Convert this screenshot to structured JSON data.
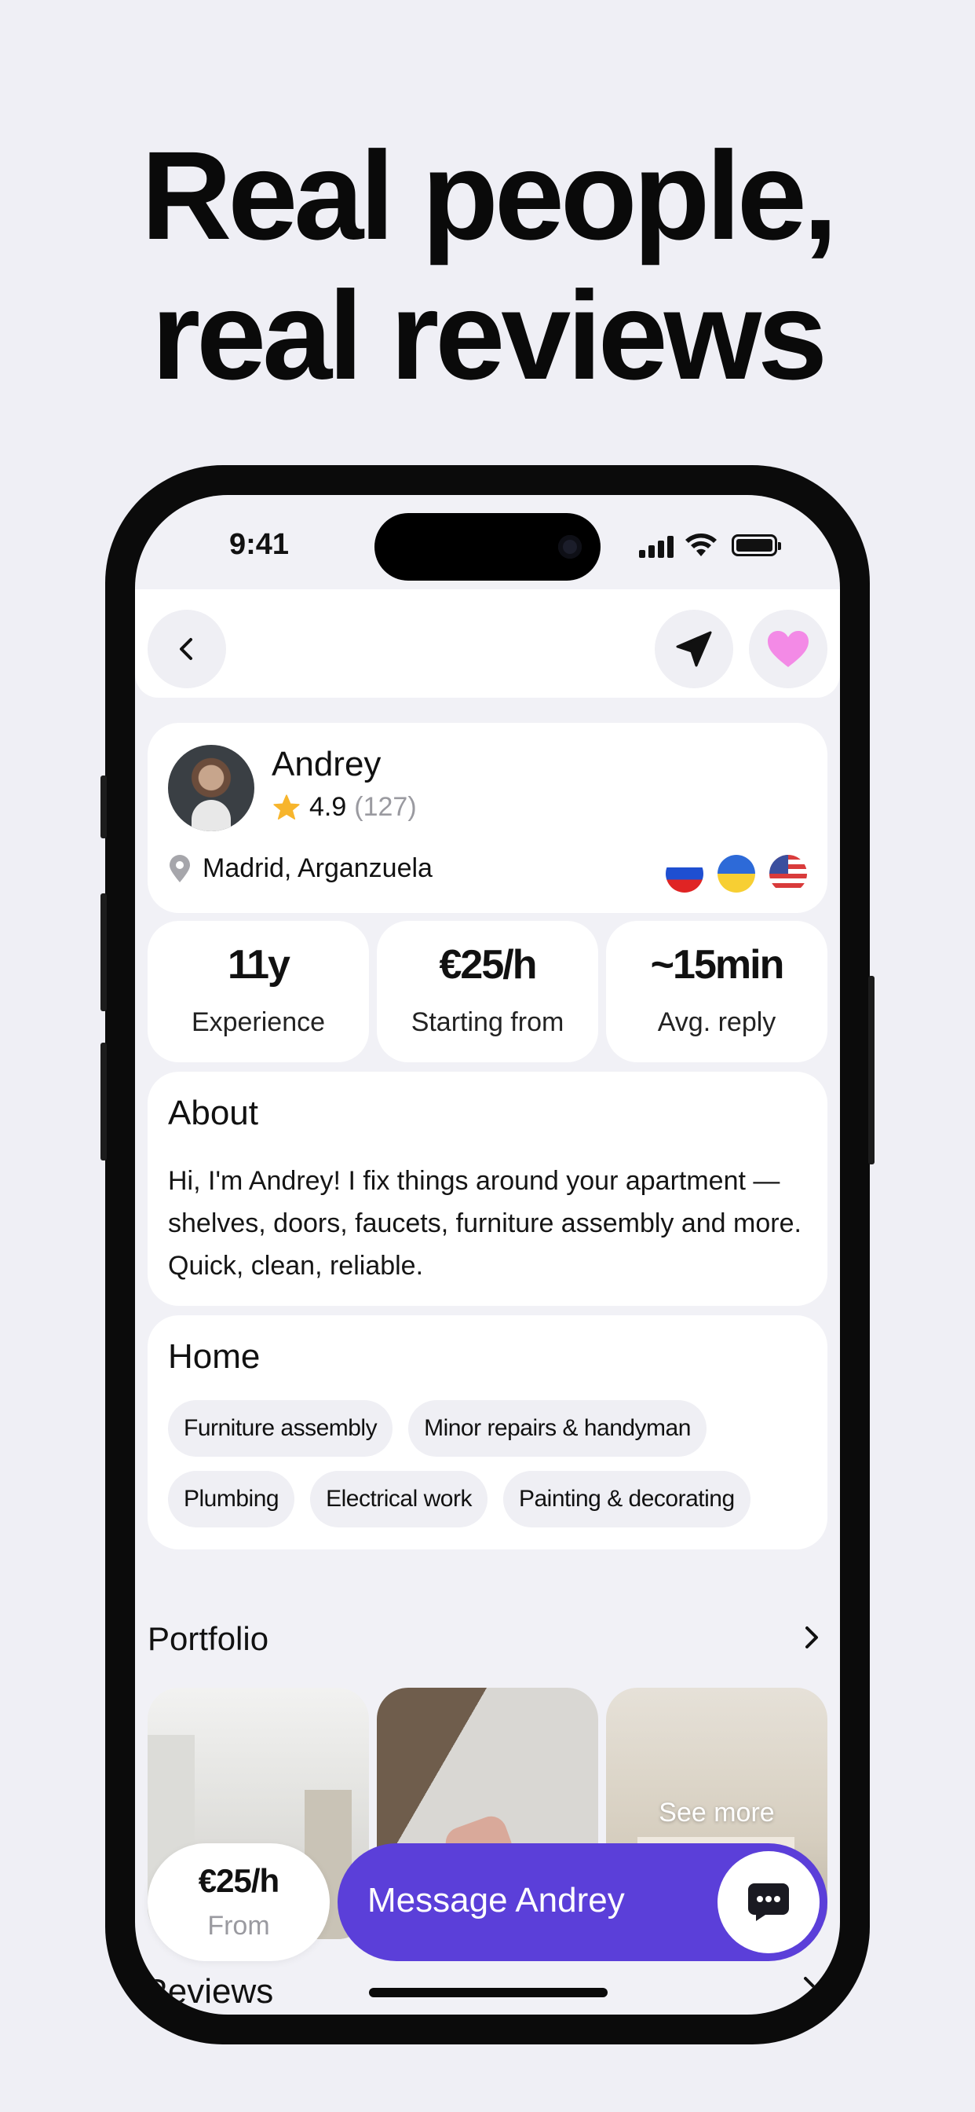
{
  "headline": {
    "line1": "Real people,",
    "line2": "real reviews"
  },
  "status_bar": {
    "time": "9:41"
  },
  "profile": {
    "name": "Andrey",
    "rating": "4.9",
    "reviews_count": "(127)",
    "location": "Madrid, Arganzuela",
    "languages": [
      "russian-flag-icon",
      "ukrainian-flag-icon",
      "us-flag-icon"
    ]
  },
  "stats": [
    {
      "value": "11y",
      "label": "Experience"
    },
    {
      "value": "€25/h",
      "label": "Starting from"
    },
    {
      "value": "~15min",
      "label": "Avg. reply"
    }
  ],
  "about": {
    "title": "About",
    "text": "Hi, I'm Andrey! I fix things around your apartment — shelves, doors, faucets, furniture assembly  and more. Quick, clean, reliable."
  },
  "home": {
    "title": "Home",
    "chips": [
      "Furniture assembly",
      "Minor repairs & handyman",
      "Plumbing",
      "Electrical work",
      "Painting & decorating"
    ]
  },
  "portfolio": {
    "title": "Portfolio",
    "see_more": "See more"
  },
  "bottom_bar": {
    "price": "€25/h",
    "price_label": "From",
    "message_button": "Message Andrey"
  },
  "reviews_title": "Reviews",
  "colors": {
    "accent": "#5b3fd9",
    "heart": "#f38ae6",
    "star": "#f7b52c",
    "background": "#efeff5"
  }
}
